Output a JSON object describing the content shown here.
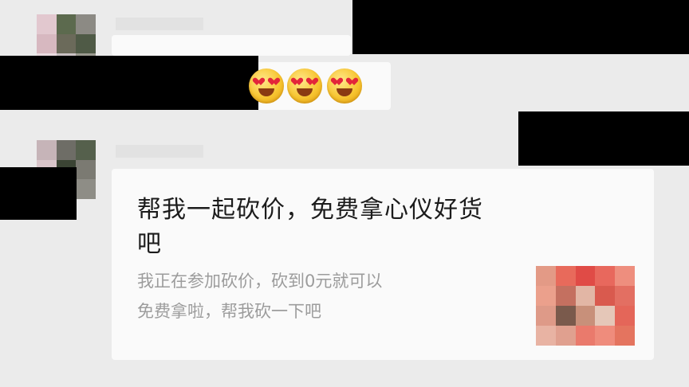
{
  "chat": {
    "messages": [
      {
        "sender_redacted": true,
        "text_redacted": true
      },
      {
        "sender_redacted": true,
        "emojis": [
          "heart-eyes-emoji",
          "heart-eyes-emoji",
          "heart-eyes-emoji"
        ]
      },
      {
        "sender_redacted": true,
        "card": {
          "title_line1": "帮我一起砍价，免费拿心仪好货",
          "title_line2": "吧",
          "desc_line1": "我正在参加砍价，砍到0元就可以",
          "desc_line2": "免费拿啦，帮我砍一下吧",
          "thumbnail_icon": "product-thumbnail-icon"
        }
      }
    ]
  },
  "colors": {
    "background": "#ebebeb",
    "bubble": "#fafafa",
    "redaction": "#000000",
    "card_title": "#1c1c1c",
    "card_desc": "#9c9c9c"
  }
}
